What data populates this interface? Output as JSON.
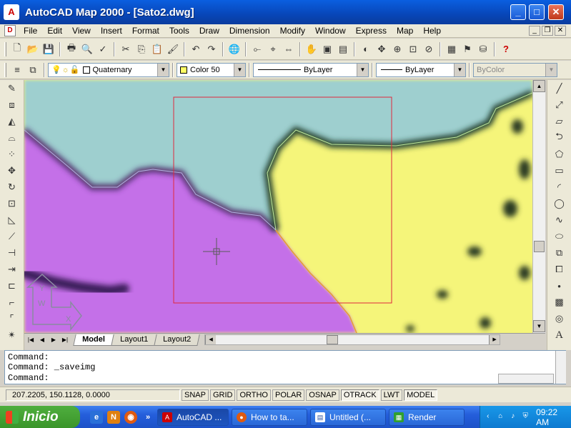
{
  "window": {
    "title": "AutoCAD Map 2000 - [Sato2.dwg]",
    "controls": [
      "_",
      "□",
      "✕"
    ]
  },
  "menu": [
    "File",
    "Edit",
    "View",
    "Insert",
    "Format",
    "Tools",
    "Draw",
    "Dimension",
    "Modify",
    "Window",
    "Express",
    "Map",
    "Help"
  ],
  "properties": {
    "layer": "Quaternary",
    "color": "Color 50",
    "linetype": "ByLayer",
    "lineweight": "ByLayer",
    "plotstyle": "ByColor"
  },
  "ucs_icon": {
    "y_label": "Y",
    "w_label": "W",
    "x_label": "X"
  },
  "layout_tabs": [
    "Model",
    "Layout1",
    "Layout2"
  ],
  "command": {
    "history": [
      "Command:",
      "Command: _saveimg"
    ],
    "prompt": "Command:"
  },
  "status": {
    "coordinates": "207.2205, 150.1128, 0.0000",
    "toggles": [
      {
        "label": "SNAP",
        "on": false
      },
      {
        "label": "GRID",
        "on": false
      },
      {
        "label": "ORTHO",
        "on": false
      },
      {
        "label": "POLAR",
        "on": false
      },
      {
        "label": "OSNAP",
        "on": false
      },
      {
        "label": "OTRACK",
        "on": true
      },
      {
        "label": "LWT",
        "on": false
      },
      {
        "label": "MODEL",
        "on": true
      }
    ]
  },
  "taskbar": {
    "start_label": "Inicio",
    "tasks": [
      "AutoCAD ...",
      "How to ta...",
      "Untitled (...",
      "Render"
    ],
    "clock": "09:22 AM"
  },
  "colors": {
    "water": "#9ecfcf",
    "purple_zone": "#c46fe8",
    "yellow_zone": "#f5f57a",
    "selection_frame": "#e0283c"
  }
}
